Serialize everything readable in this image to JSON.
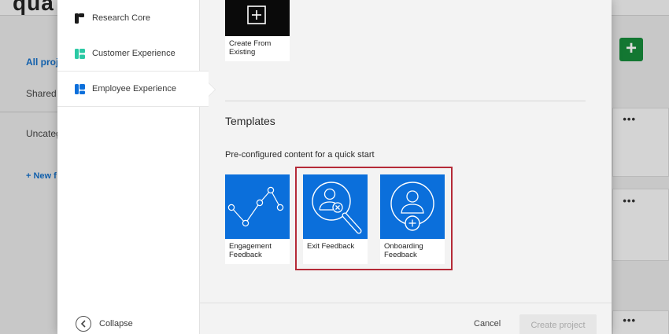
{
  "background": {
    "logo_text": "qua",
    "nav": [
      {
        "label": "All proje",
        "active": true
      },
      {
        "label": "Shared w",
        "active": false
      },
      {
        "label": "Uncateg",
        "active": false
      }
    ],
    "new_folder": "+ New f",
    "add_button": "+",
    "card_menu": "•••"
  },
  "sidebar": {
    "items": [
      {
        "label": "Research Core",
        "icon": "research-core-icon"
      },
      {
        "label": "Customer Experience",
        "icon": "customer-experience-icon"
      },
      {
        "label": "Employee Experience",
        "icon": "employee-experience-icon"
      }
    ],
    "collapse_label": "Collapse"
  },
  "create_from_existing": {
    "label_line1": "Create From",
    "label_line2": "Existing"
  },
  "templates": {
    "title": "Templates",
    "subtitle": "Pre-configured content for a quick start",
    "items": [
      {
        "label_line1": "Engagement",
        "label_line2": "Feedback",
        "icon": "engagement-chart-icon"
      },
      {
        "label_line1": "Exit Feedback",
        "label_line2": "",
        "icon": "exit-feedback-icon"
      },
      {
        "label_line1": "Onboarding",
        "label_line2": "Feedback",
        "icon": "onboarding-feedback-icon"
      }
    ]
  },
  "footer": {
    "cancel_label": "Cancel",
    "create_label": "Create project"
  },
  "colors": {
    "tile_blue": "#0b6fdb",
    "highlight_red": "#b52a37",
    "add_green": "#168a3a",
    "link_blue": "#1570c8"
  }
}
